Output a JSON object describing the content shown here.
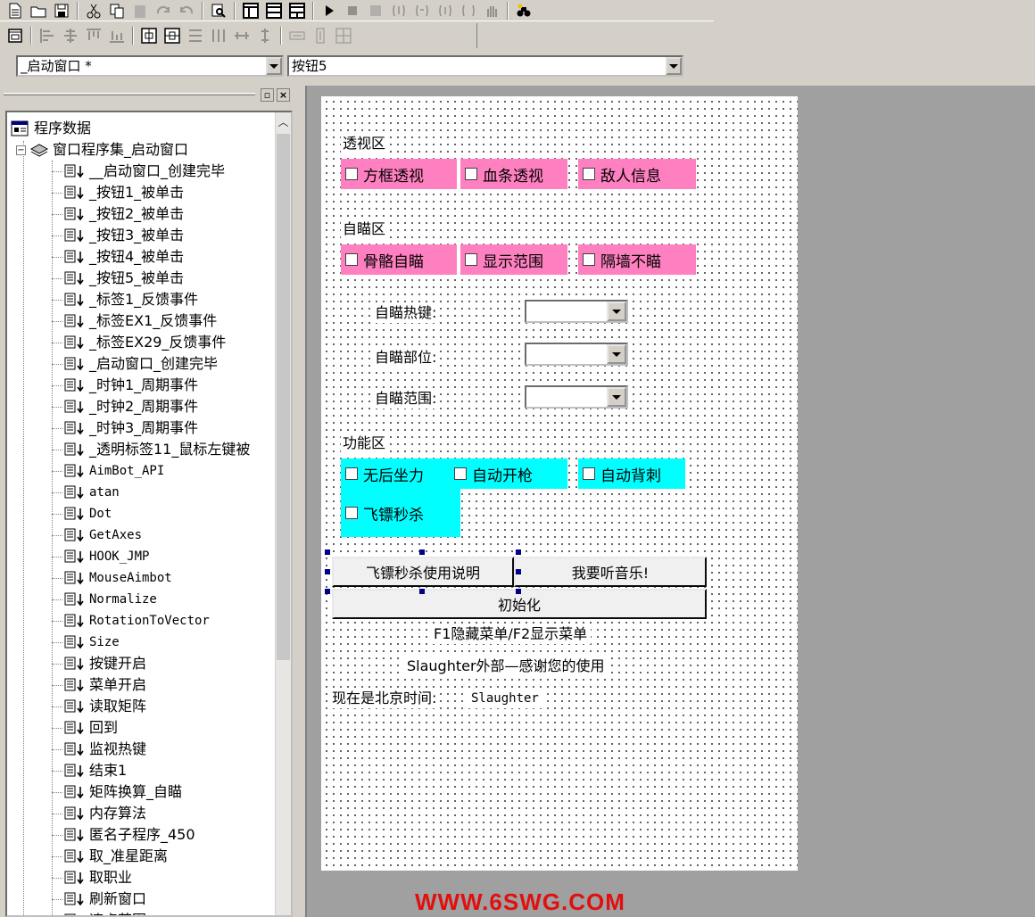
{
  "toolbar": {
    "row1": [
      "new-file-icon",
      "open-folder-icon",
      "save-icon",
      "cut-icon",
      "copy-icon",
      "paste-icon",
      "redo-icon",
      "undo-icon",
      "find-icon",
      "layout-1-icon",
      "layout-2-icon",
      "layout-3-icon",
      "run-icon",
      "stop-icon",
      "compile-icon",
      "step-in-icon",
      "step-over-icon",
      "step-out-icon",
      "step-back-icon",
      "hand-icon",
      "binoculars-icon"
    ],
    "row2": [
      "form-icon",
      "align-left-icon",
      "align-center-icon",
      "align-top-icon",
      "align-bottom-icon",
      "center-horizontal-icon",
      "center-vertical-icon",
      "space-h-icon",
      "space-v-icon",
      "equal-width-icon",
      "equal-height-icon",
      "expand-h-icon",
      "expand-v-icon",
      "grid-icon"
    ]
  },
  "combo_window": {
    "value": "_启动窗口 *"
  },
  "combo_control": {
    "value": "按钮5"
  },
  "panel": {
    "min_glyph": "▫",
    "close_glyph": "×"
  },
  "tree": {
    "root": "程序数据",
    "module": "窗口程序集_启动窗口",
    "items": [
      "__启动窗口_创建完毕",
      "_按钮1_被单击",
      "_按钮2_被单击",
      "_按钮3_被单击",
      "_按钮4_被单击",
      "_按钮5_被单击",
      "_标签1_反馈事件",
      "_标签EX1_反馈事件",
      "_标签EX29_反馈事件",
      "_启动窗口_创建完毕",
      "_时钟1_周期事件",
      "_时钟2_周期事件",
      "_时钟3_周期事件",
      "_透明标签11_鼠标左键被",
      "AimBot_API",
      "atan",
      "Dot",
      "GetAxes",
      "HOOK_JMP",
      "MouseAimbot",
      "Normalize",
      "RotationToVector",
      "Size",
      "按键开启",
      "菜单开启",
      "读取矩阵",
      "回到",
      "监视热键",
      "结束1",
      "矩阵换算_自瞄",
      "内存算法",
      "匿名子程序_450",
      "取_准星距离",
      "取职业",
      "刷新窗口",
      "速点范围"
    ]
  },
  "form": {
    "section_perspective": "透视区",
    "chk_box_esp": "方框透视",
    "chk_blood_esp": "血条透视",
    "chk_enemy_info": "敌人信息",
    "section_aim": "自瞄区",
    "chk_bone_aim": "骨骼自瞄",
    "chk_show_range": "显示范围",
    "chk_wall_no_aim": "隔墙不瞄",
    "label_hotkey": "自瞄热键:",
    "label_part": "自瞄部位:",
    "label_range": "自瞄范围:",
    "section_function": "功能区",
    "chk_no_recoil": "无后坐力",
    "chk_auto_fire": "自动开枪",
    "chk_auto_backstab": "自动背刺",
    "chk_dart_kill": "飞镖秒杀",
    "btn_dart_help": "飞镖秒杀使用说明",
    "btn_music": "我要听音乐!",
    "btn_init": "初始化",
    "line_hotkeys": "F1隐藏菜单/F2显示菜单",
    "line_thanks": "Slaughter外部—感谢您的使用",
    "label_time": "现在是北京时间:",
    "time_value": "Slaughter"
  },
  "watermark": "WWW.6SWG.COM",
  "colors": {
    "pink": "#ff80c0",
    "cyan": "#00ffff",
    "handle": "#00008b",
    "watermark": "#e01010"
  }
}
